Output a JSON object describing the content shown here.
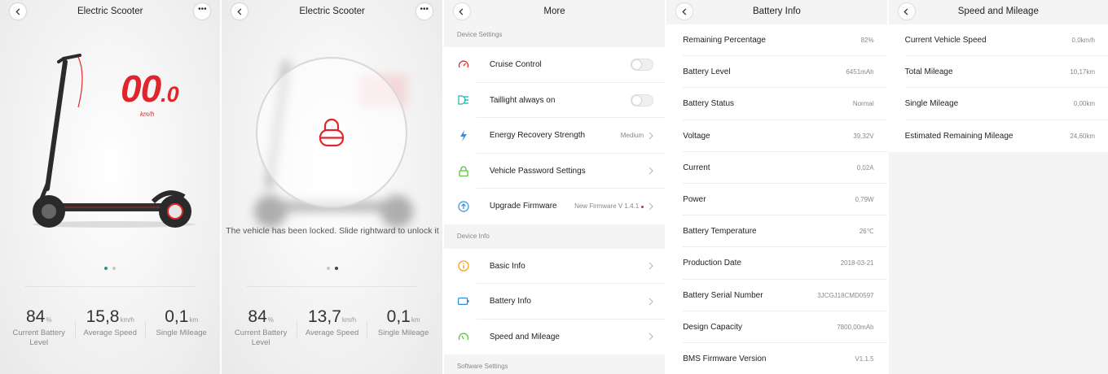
{
  "dashboard": {
    "title": "Electric Scooter",
    "speed_big": "00",
    "speed_small": ".0",
    "speed_unit": "km/h",
    "stats": [
      {
        "value": "84",
        "unit": "%",
        "label": "Current Battery Level"
      },
      {
        "value": "15,8",
        "unit": "km/h",
        "label": "Average Speed"
      },
      {
        "value": "0,1",
        "unit": "km",
        "label": "Single Mileage"
      }
    ]
  },
  "locked": {
    "title": "Electric Scooter",
    "message": "The vehicle has been locked. Slide rightward to unlock it",
    "stats": [
      {
        "value": "84",
        "unit": "%",
        "label": "Current Battery Level"
      },
      {
        "value": "13,7",
        "unit": "km/h",
        "label": "Average Speed"
      },
      {
        "value": "0,1",
        "unit": "km",
        "label": "Single Mileage"
      }
    ]
  },
  "more": {
    "title": "More",
    "device_settings_label": "Device Settings",
    "device_settings": [
      {
        "label": "Cruise Control",
        "icon": "gauge-icon"
      },
      {
        "label": "Taillight always on",
        "icon": "taillight-icon"
      },
      {
        "label": "Energy Recovery Strength",
        "value": "Medium",
        "icon": "lightning-icon"
      },
      {
        "label": "Vehicle Password Settings",
        "icon": "lock-icon"
      },
      {
        "label": "Upgrade Firmware",
        "value": "New Firmware V 1.4.1",
        "icon": "upgrade-icon"
      }
    ],
    "device_info_label": "Device Info",
    "device_info": [
      {
        "label": "Basic Info",
        "icon": "info-icon"
      },
      {
        "label": "Battery Info",
        "icon": "battery-icon"
      },
      {
        "label": "Speed and Mileage",
        "icon": "speedometer-icon"
      }
    ],
    "software_settings_label": "Software Settings"
  },
  "battery": {
    "title": "Battery Info",
    "items": [
      {
        "label": "Remaining Percentage",
        "value": "82%"
      },
      {
        "label": "Battery Level",
        "value": "6451mAh"
      },
      {
        "label": "Battery Status",
        "value": "Normal"
      },
      {
        "label": "Voltage",
        "value": "39,32V"
      },
      {
        "label": "Current",
        "value": "0,02A"
      },
      {
        "label": "Power",
        "value": "0,79W"
      },
      {
        "label": "Battery Temperature",
        "value": "26℃"
      },
      {
        "label": "Production Date",
        "value": "2018-03-21"
      },
      {
        "label": "Battery Serial Number",
        "value": "3JCGJ18CMD0597"
      },
      {
        "label": "Design Capacity",
        "value": "7800,00mAh"
      },
      {
        "label": "BMS Firmware Version",
        "value": "V1.1.5"
      }
    ]
  },
  "mileage": {
    "title": "Speed and Mileage",
    "items": [
      {
        "label": "Current Vehicle Speed",
        "value": "0,0km/h"
      },
      {
        "label": "Total Mileage",
        "value": "10,17km"
      },
      {
        "label": "Single Mileage",
        "value": "0,00km"
      },
      {
        "label": "Estimated Remaining Mileage",
        "value": "24,60km"
      }
    ]
  },
  "colors": {
    "accent_red": "#e0262d",
    "toggle_off": "#f0f0f0"
  }
}
